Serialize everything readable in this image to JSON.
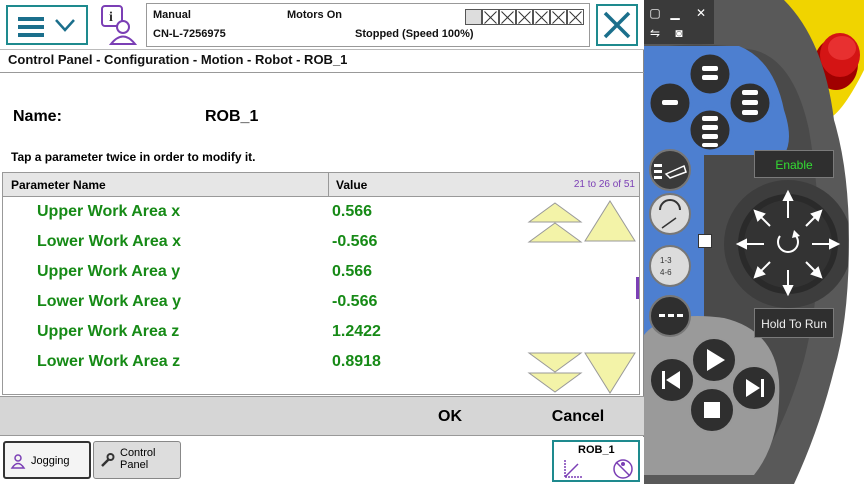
{
  "topbar": {
    "operating_mode": "Manual",
    "controller_name": "CN-L-7256975",
    "motors_state": "Motors On",
    "program_state": "Stopped (Speed 100%)"
  },
  "breadcrumb": "Control Panel - Configuration - Motion - Robot - ROB_1",
  "name": {
    "label": "Name:",
    "value": "ROB_1"
  },
  "hint": "Tap a parameter twice in order to modify it.",
  "table": {
    "headers": {
      "name": "Parameter Name",
      "value": "Value"
    },
    "range": "21 to 26 of 51",
    "rows": [
      {
        "name": "Upper Work Area x",
        "value": "0.566"
      },
      {
        "name": "Lower Work Area x",
        "value": "-0.566"
      },
      {
        "name": "Upper Work Area y",
        "value": "0.566"
      },
      {
        "name": "Lower Work Area y",
        "value": "-0.566"
      },
      {
        "name": "Upper Work Area z",
        "value": "1.2422"
      },
      {
        "name": "Lower Work Area z",
        "value": "0.8918"
      }
    ]
  },
  "actions": {
    "ok": "OK",
    "cancel": "Cancel"
  },
  "taskbar": {
    "jogging": "Jogging",
    "control_panel": "Control Panel",
    "mechanical_unit": "ROB_1"
  },
  "device": {
    "enable": "Enable",
    "hold_to_run": "Hold To Run"
  },
  "colors": {
    "accent": "#1e8a8e",
    "param_text": "#168a16",
    "range_text": "#7b3fb5",
    "scroll_arrow": "#f3f3a8",
    "device_blue": "#4d7fd0",
    "device_red": "#cc0000",
    "device_yellow": "#f0d400"
  }
}
